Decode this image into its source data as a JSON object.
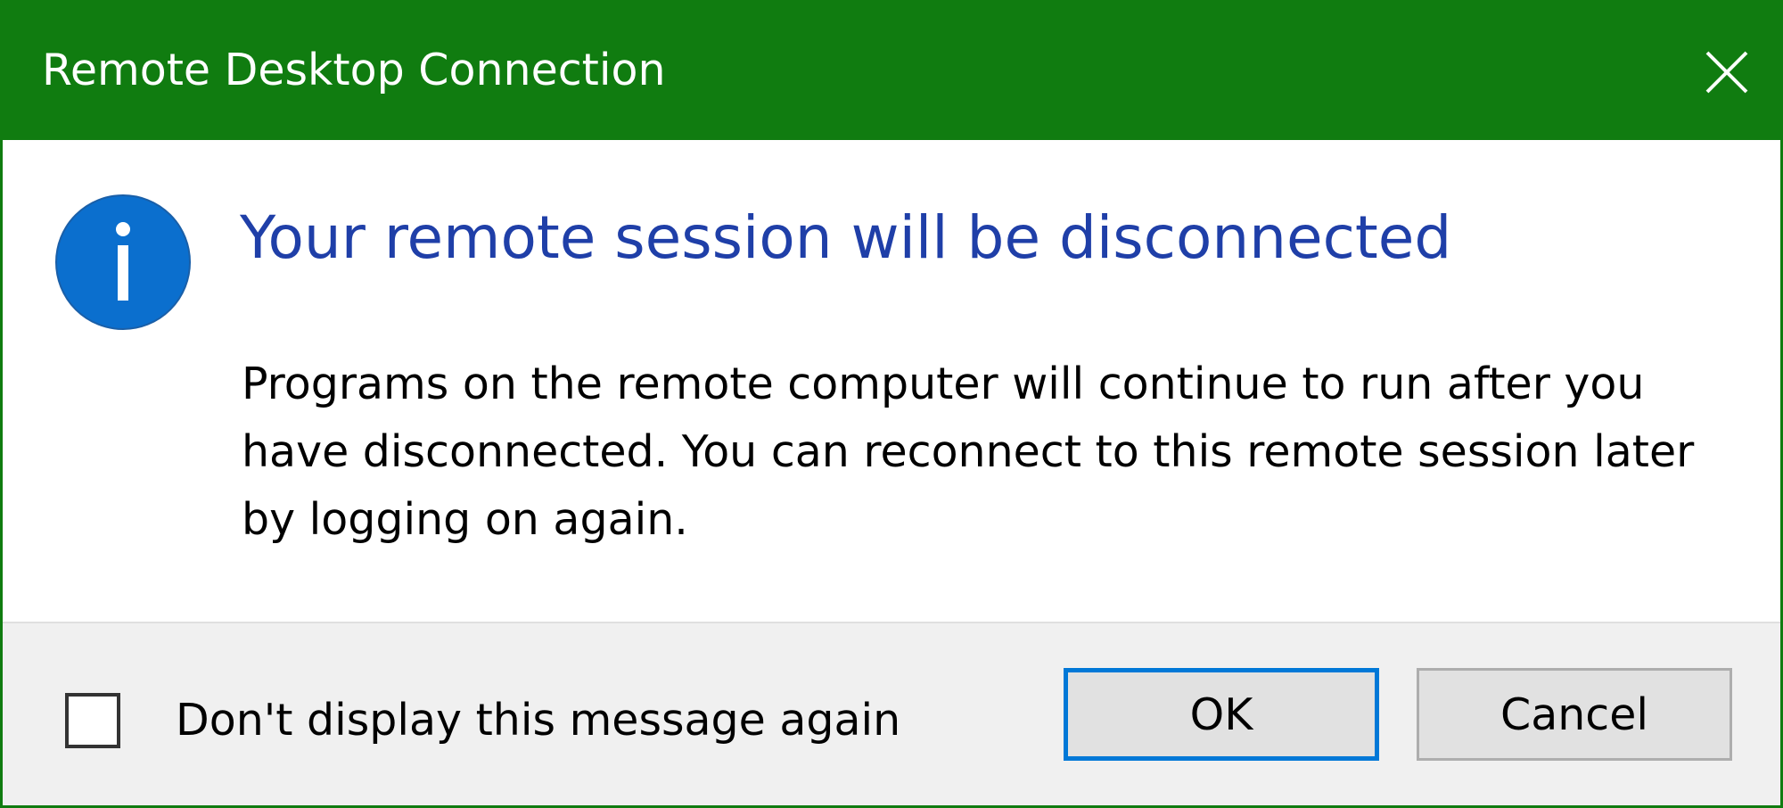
{
  "window": {
    "title": "Remote Desktop Connection",
    "accent_color": "#107c10"
  },
  "title_bar": {
    "close_icon": "close-icon"
  },
  "content": {
    "icon": "info-icon",
    "icon_color": "#0b6fce",
    "main_instruction": "Your remote session will be disconnected",
    "main_instruction_color": "#1f3fa8",
    "body_text": "Programs on the remote computer will continue to run after you have disconnected. You can reconnect to this remote session later by logging on again."
  },
  "footer": {
    "checkbox_label": "Don't display this message again",
    "checkbox_checked": false,
    "ok_label": "OK",
    "cancel_label": "Cancel",
    "focus_color": "#0078d7"
  }
}
